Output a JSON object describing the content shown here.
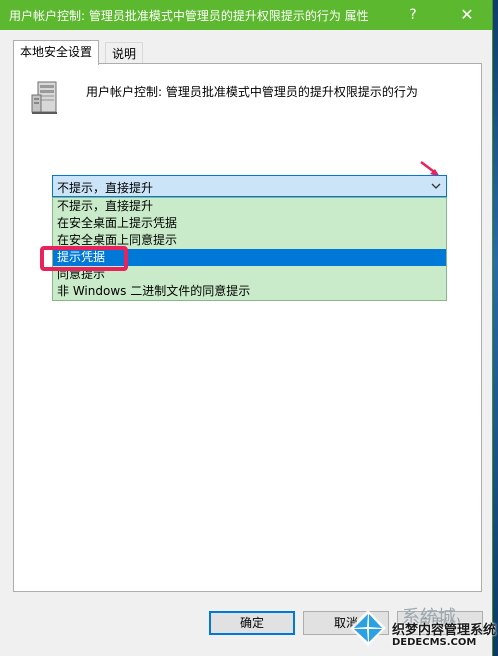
{
  "window": {
    "title": "用户帐户控制: 管理员批准模式中管理员的提升权限提示的行为 属性",
    "help_glyph": "?",
    "close_glyph": "✕"
  },
  "tabs": [
    {
      "label": "本地安全设置",
      "active": true
    },
    {
      "label": "说明",
      "active": false
    }
  ],
  "policy": {
    "title": "用户帐户控制: 管理员批准模式中管理员的提升权限提示的行为",
    "icon": "server-icon"
  },
  "combo": {
    "value": "不提示，直接提升"
  },
  "dropdown": {
    "options": [
      "不提示，直接提升",
      "在安全桌面上提示凭据",
      "在安全桌面上同意提示",
      "提示凭据",
      "同意提示",
      "非 Windows 二进制文件的同意提示"
    ],
    "selected_index": 3
  },
  "buttons": {
    "ok": "确定",
    "cancel": "取消",
    "apply": "应用(A)"
  },
  "watermark": {
    "line1": "织梦内容管理系统",
    "line2": "DEDECMS.COM",
    "faded": "系统城"
  },
  "colors": {
    "titlebar": "#5cb82e",
    "selection": "#0078d7",
    "dropdown_bg": "#c9ebc9",
    "highlight": "#e8225a"
  }
}
